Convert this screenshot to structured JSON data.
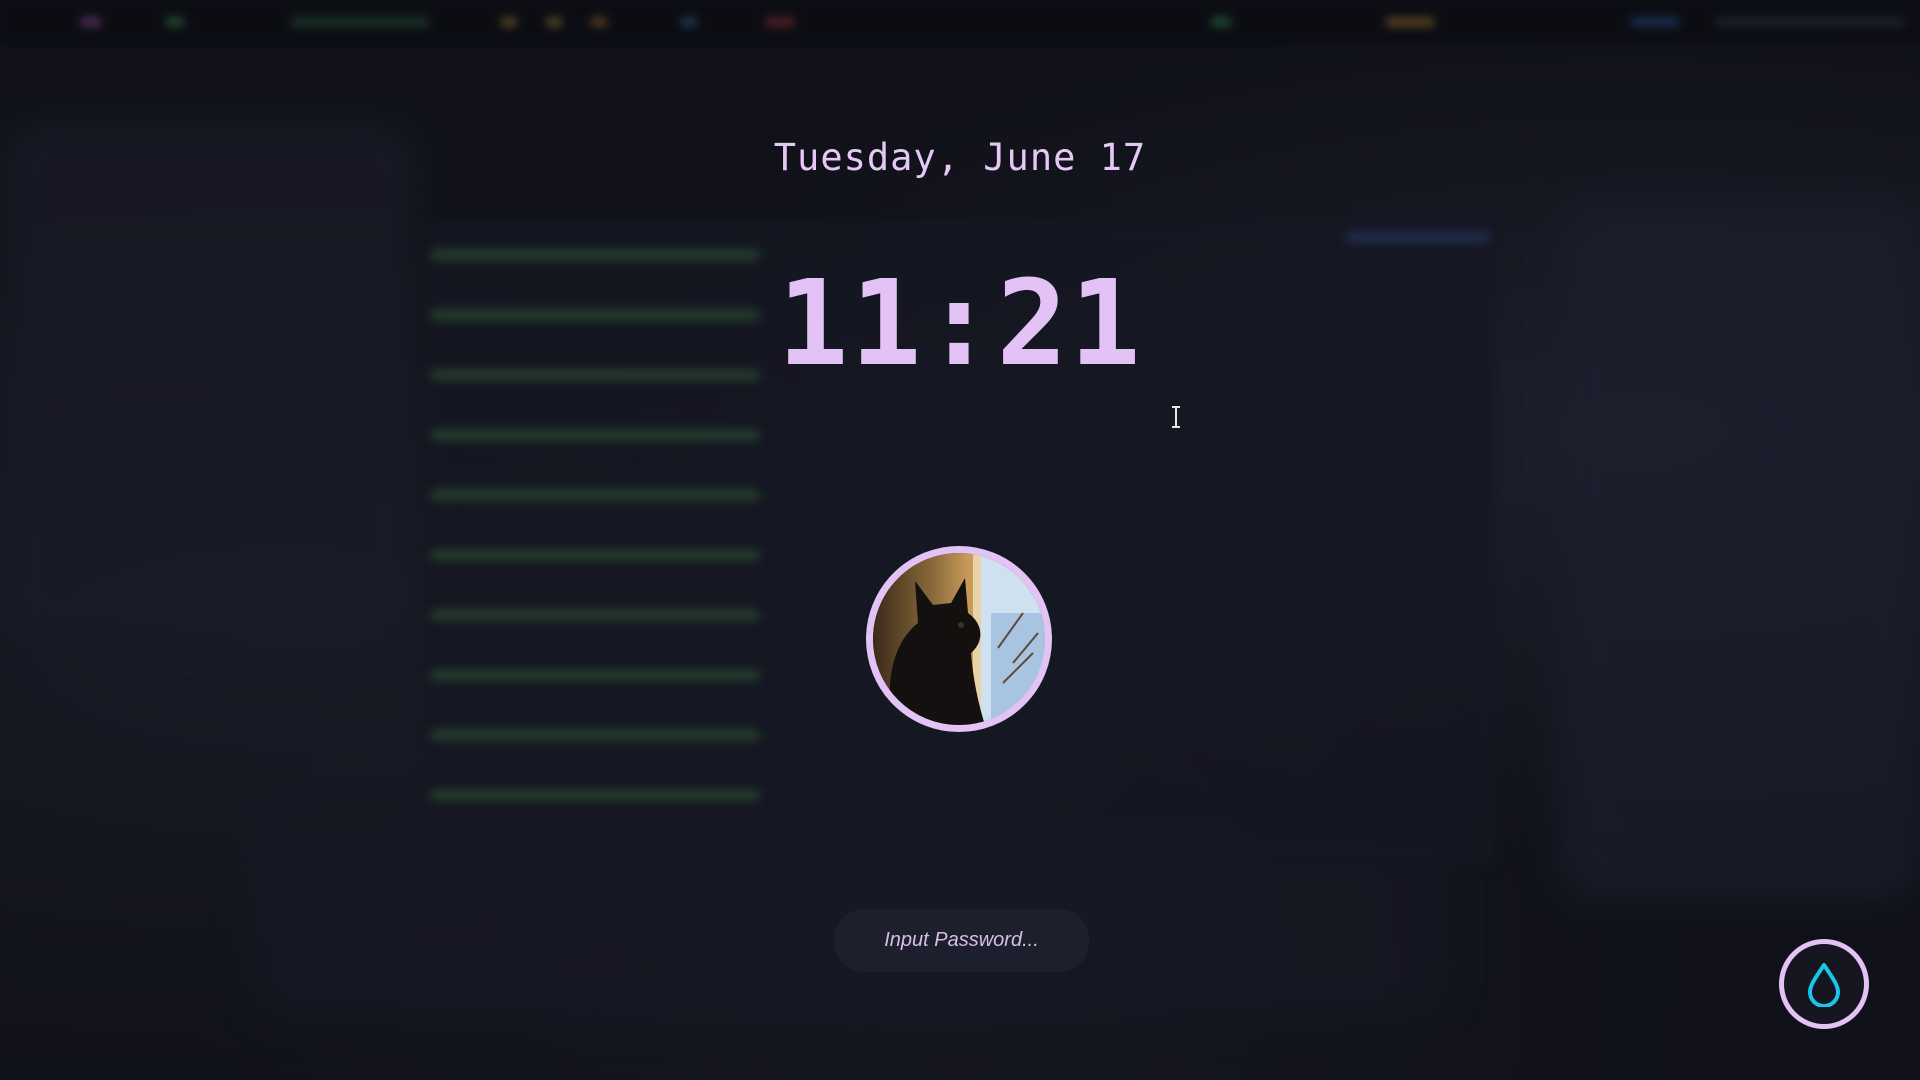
{
  "lockscreen": {
    "date": "Tuesday, June 17",
    "time": "11:21",
    "password": {
      "placeholder": "Input Password...",
      "value": ""
    },
    "avatar_icon": "user-avatar-cat-photo",
    "action_icon": "water-drop-icon"
  },
  "colors": {
    "accent": "#e3c2f6",
    "background": "#101119",
    "input_bg": "#1e1f2c",
    "icon_cyan": "#18c6e6"
  }
}
